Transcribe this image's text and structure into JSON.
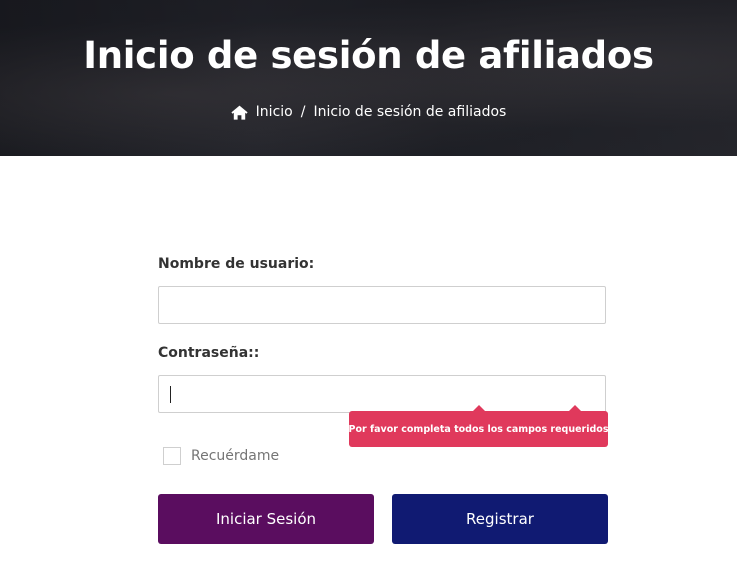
{
  "header": {
    "title": "Inicio de sesión de afiliados",
    "breadcrumb": {
      "home_icon": "home-icon",
      "home": "Inicio",
      "separator": "/",
      "current": "Inicio de sesión de afiliados"
    }
  },
  "form": {
    "username_label": "Nombre de usuario:",
    "username_value": "",
    "password_label": "Contraseña::",
    "password_value": "",
    "remember_label": "Recuérdame",
    "remember_checked": false,
    "validation_tooltip": "¡Por favor completa todos los campos requeridos!",
    "login_button": "Iniciar Sesión",
    "register_button": "Registrar"
  },
  "colors": {
    "login_button": "#5a0d5f",
    "register_button": "#101a72",
    "tooltip": "#e0395c"
  }
}
